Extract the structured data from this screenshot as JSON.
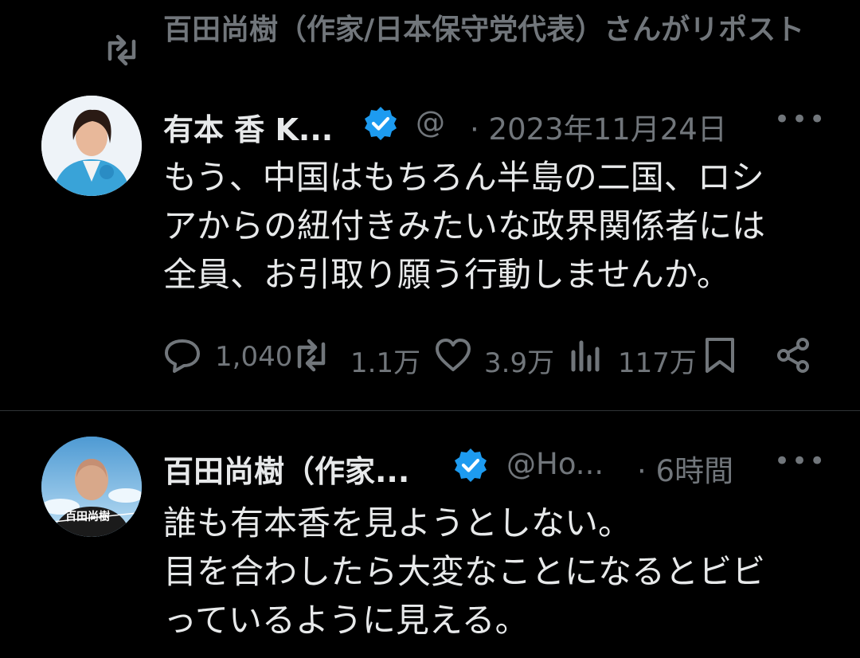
{
  "repost_header": {
    "text": "百田尚樹（作家/日本保守党代表）さんがリポスト"
  },
  "tweet1": {
    "author_name": "有本 香 K...",
    "handle": "@",
    "timestamp": "· 2023年11月24日",
    "more": "•••",
    "lines": [
      "もう、中国はもちろん半島の二国、ロシ",
      "アからの紐付きみたいな政界関係者には",
      "全員、お引取り願う行動しませんか。"
    ],
    "actions": {
      "replies": "1,040",
      "reposts": "1.1万",
      "likes": "3.9万",
      "views": "117万"
    }
  },
  "tweet2": {
    "author_name": "百田尚樹（作家...",
    "handle": "@Ho...",
    "timestamp": "· 6時間",
    "more": "•••",
    "avatar_caption": "百田尚樹",
    "lines": [
      "誰も有本香を見ようとしない。",
      "目を合わしたら大変なことになるとビビ",
      "っているように見える。"
    ]
  },
  "colors": {
    "background": "#000000",
    "text": "#e7e9ea",
    "muted": "#71767b",
    "verified": "#1d9bf0",
    "divider": "#2f3336"
  },
  "icons": [
    "repost-icon",
    "verified-badge-icon",
    "reply-icon",
    "like-icon",
    "views-icon",
    "bookmark-icon",
    "share-icon"
  ]
}
